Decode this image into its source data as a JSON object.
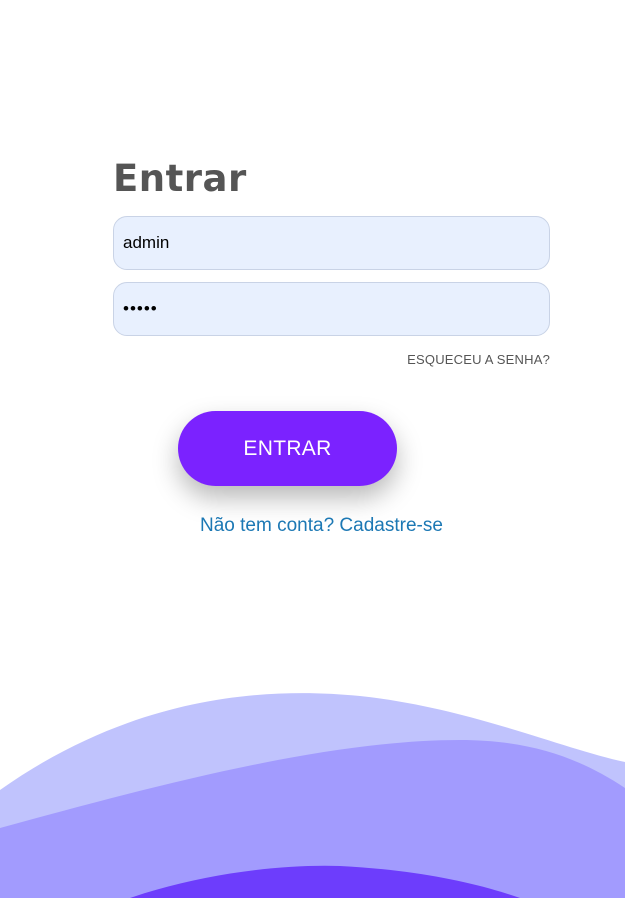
{
  "login": {
    "title": "Entrar",
    "username_value": "admin",
    "password_value": "•••••",
    "forgot_password": "ESQUECEU A SENHA?",
    "submit_label": "ENTRAR",
    "signup_link": "Não tem conta? Cadastre-se"
  },
  "colors": {
    "button": "#7b22ff",
    "input_bg": "#e8f0fe",
    "link": "#1c78b4",
    "wave_light": "#c0c3fd",
    "wave_mid": "#a29bfe",
    "wave_dark": "#6d3dfc"
  }
}
